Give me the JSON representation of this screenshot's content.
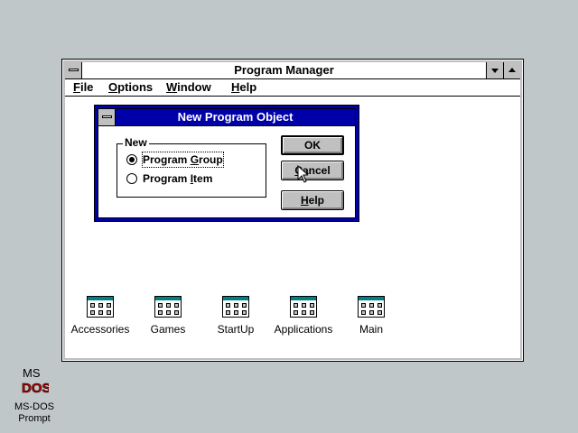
{
  "program_manager": {
    "title": "Program Manager",
    "menu": [
      {
        "label": "File",
        "underline": "F",
        "rest": "ile"
      },
      {
        "label": "Options",
        "underline": "O",
        "rest": "ptions"
      },
      {
        "label": "Window",
        "underline": "W",
        "rest": "indow"
      },
      {
        "label": "Help",
        "underline": "H",
        "rest": "elp"
      }
    ],
    "groups": [
      {
        "label": "Accessories",
        "icon": "program-group-icon"
      },
      {
        "label": "Games",
        "icon": "program-group-icon"
      },
      {
        "label": "StartUp",
        "icon": "program-group-icon"
      },
      {
        "label": "Applications",
        "icon": "program-group-icon"
      },
      {
        "label": "Main",
        "icon": "program-group-icon"
      }
    ]
  },
  "dialog": {
    "title": "New Program Object",
    "groupbox_label": "New",
    "options": [
      {
        "label": "Program Group",
        "prefix": "Program ",
        "underline": "G",
        "rest": "roup",
        "selected": true
      },
      {
        "label": "Program Item",
        "prefix": "Program ",
        "underline": "I",
        "rest": "tem",
        "selected": false
      }
    ],
    "buttons": {
      "ok": "OK",
      "cancel": {
        "label": "Cancel",
        "underline": "C",
        "rest": "ancel"
      },
      "help": {
        "label": "Help",
        "underline": "H",
        "rest": "elp"
      }
    }
  },
  "desktop": {
    "icon_label_line1": "MS-DOS",
    "icon_label_line2": "Prompt",
    "icon_logo_line1": "MS",
    "icon_logo_line2": "DOS"
  },
  "colors": {
    "desktop": "#c0c7c8",
    "dialog_title": "#0000a8",
    "window_bg": "#ffffff"
  }
}
